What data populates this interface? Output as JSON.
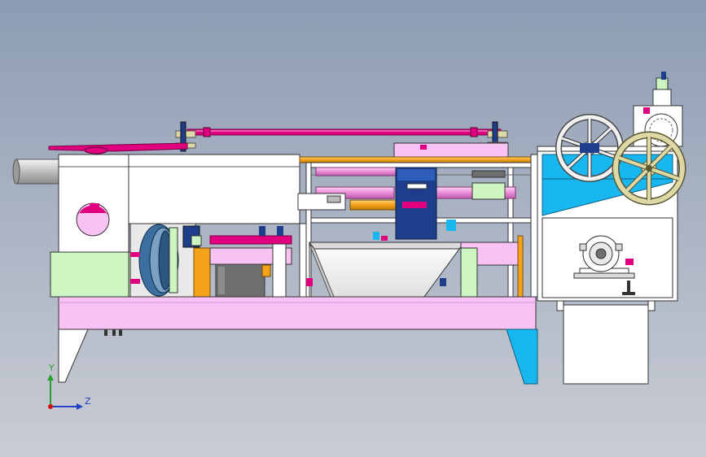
{
  "axes": {
    "y_label": "Y",
    "z_label": "Z"
  },
  "colors": {
    "frame_white": "#ffffff",
    "panel_pink": "#f9c2f4",
    "accent_magenta": "#e0007f",
    "panel_green": "#ccf5c2",
    "panel_cyan": "#19b7f0",
    "part_orange": "#f3a21a",
    "part_navy": "#1e3e8c",
    "wheel_khaki": "#ddd8a6",
    "motor_gray": "#6f6f6f"
  }
}
